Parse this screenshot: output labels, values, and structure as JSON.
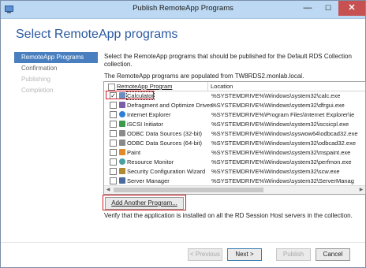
{
  "window": {
    "title": "Publish RemoteApp Programs",
    "min": "—",
    "max": "☐",
    "close": "✕"
  },
  "heading": "Select RemoteApp programs",
  "steps": [
    {
      "label": "RemoteApp Programs"
    },
    {
      "label": "Confirmation"
    },
    {
      "label": "Publishing"
    },
    {
      "label": "Completion"
    }
  ],
  "description": "Select the RemoteApp programs that should be published for the Default RDS Collection collection.",
  "populated_text": "The RemoteApp programs are populated from TW8RDS2.monlab.local.",
  "list": {
    "col_program": "RemoteApp Program",
    "col_location": "Location",
    "rows": [
      {
        "name": "Calculator",
        "location": "%SYSTEMDRIVE%\\Windows\\system32\\calc.exe",
        "checked": true,
        "icon": "calculator-icon"
      },
      {
        "name": "Defragment and Optimize Drives",
        "location": "%SYSTEMDRIVE%\\Windows\\system32\\dfrgui.exe",
        "checked": false,
        "icon": "defrag-icon"
      },
      {
        "name": "Internet Explorer",
        "location": "%SYSTEMDRIVE%\\Program Files\\Internet Explorer\\ie",
        "checked": false,
        "icon": "ie-icon"
      },
      {
        "name": "iSCSI Initiator",
        "location": "%SYSTEMDRIVE%\\Windows\\system32\\iscsicpl.exe",
        "checked": false,
        "icon": "iscsi-icon"
      },
      {
        "name": "ODBC Data Sources (32-bit)",
        "location": "%SYSTEMDRIVE%\\Windows\\syswow64\\odbcad32.exe",
        "checked": false,
        "icon": "odbc-icon"
      },
      {
        "name": "ODBC Data Sources (64-bit)",
        "location": "%SYSTEMDRIVE%\\Windows\\system32\\odbcad32.exe",
        "checked": false,
        "icon": "odbc-icon"
      },
      {
        "name": "Paint",
        "location": "%SYSTEMDRIVE%\\Windows\\system32\\mspaint.exe",
        "checked": false,
        "icon": "paint-icon"
      },
      {
        "name": "Resource Monitor",
        "location": "%SYSTEMDRIVE%\\Windows\\system32\\perfmon.exe",
        "checked": false,
        "icon": "resmon-icon"
      },
      {
        "name": "Security Configuration Wizard",
        "location": "%SYSTEMDRIVE%\\Windows\\system32\\scw.exe",
        "checked": false,
        "icon": "security-icon"
      },
      {
        "name": "Server Manager",
        "location": "%SYSTEMDRIVE%\\Windows\\system32\\ServerManag",
        "checked": false,
        "icon": "server-manager-icon"
      }
    ]
  },
  "add_button": "Add Another Program...",
  "verify_text": "Verify that the application is installed on all the RD Session Host servers in the collection.",
  "buttons": {
    "previous": "< Previous",
    "next": "Next >",
    "publish": "Publish",
    "cancel": "Cancel"
  },
  "colors": {
    "accent": "#4a7fbf",
    "heading": "#2a5aa0",
    "highlight": "#d61f26",
    "titlebar": "#bcd8f2"
  }
}
